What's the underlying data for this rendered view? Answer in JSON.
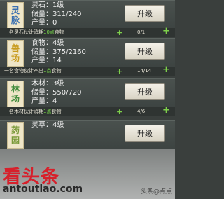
{
  "buildings": [
    {
      "badge_top": "灵",
      "badge_bottom": "脉",
      "line1": "灵石：1级",
      "line2": "储量：311/240",
      "line3": "产量：0",
      "upgrade_label": "升级",
      "worker_pre": "一名灵石伙计消耗",
      "worker_hl": "10点",
      "worker_post": "食物",
      "worker_count": "0/1"
    },
    {
      "badge_top": "兽",
      "badge_bottom": "场",
      "line1": "食物：4级",
      "line2": "储量：375/2160",
      "line3": "产量：14",
      "upgrade_label": "升级",
      "worker_pre": "一名食物伙计产出",
      "worker_hl": "1点",
      "worker_post": "食物",
      "worker_count": "14/14"
    },
    {
      "badge_top": "林",
      "badge_bottom": "场",
      "line1": "木材：3级",
      "line2": "储量：550/720",
      "line3": "产量：4",
      "upgrade_label": "升级",
      "worker_pre": "一名木材伙计消耗",
      "worker_hl": "1点",
      "worker_post": "食物",
      "worker_count": "4/6"
    },
    {
      "badge_top": "药",
      "badge_bottom": "园",
      "line1": "灵草：4级",
      "line2": "",
      "line3": "",
      "upgrade_label": "升级",
      "worker_pre": "",
      "worker_hl": "",
      "worker_post": "",
      "worker_count": ""
    }
  ],
  "controls": {
    "minus": "+",
    "plus": "+"
  },
  "watermark": {
    "logo": "看头条",
    "url": "antoutiao.com",
    "user": "头条@点点"
  },
  "colors": {
    "highlight": "#79d94a",
    "plus": "#7ed04b",
    "badge_bg": "#efe6c8"
  }
}
